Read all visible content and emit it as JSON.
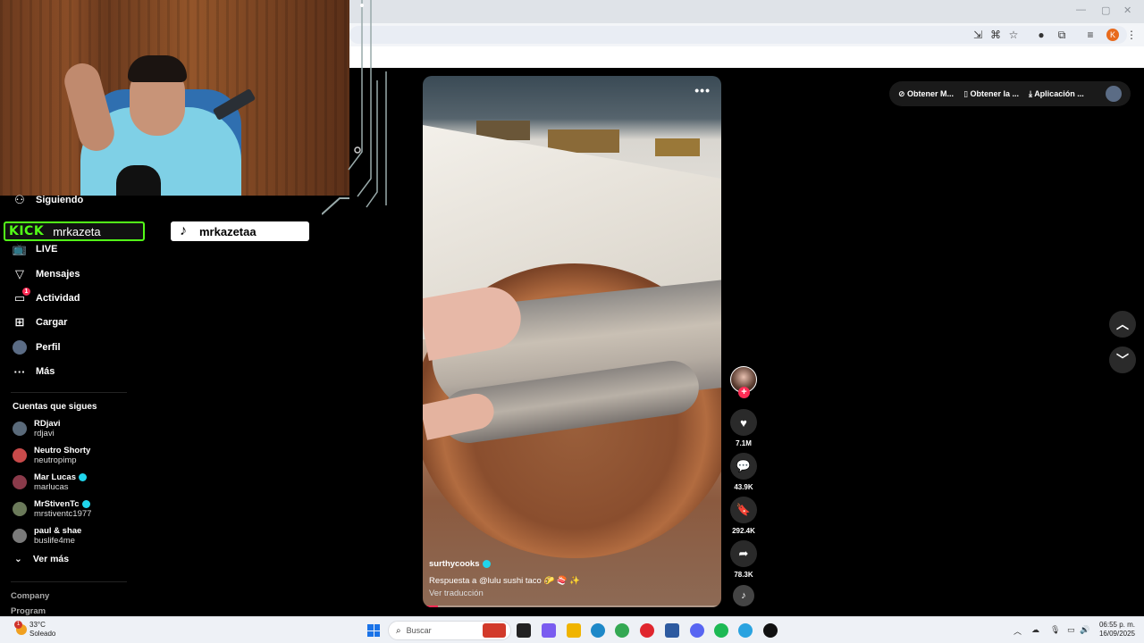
{
  "browser": {
    "minimize": "—",
    "maximize": "▢",
    "close": "✕",
    "profile_initial": "K"
  },
  "sidebar": {
    "items": [
      {
        "label": "Siguiendo",
        "icon": "following-icon"
      },
      {
        "label": "LIVE",
        "icon": "live-icon"
      },
      {
        "label": "Mensajes",
        "icon": "messages-icon"
      },
      {
        "label": "Actividad",
        "icon": "activity-icon",
        "badge": "1"
      },
      {
        "label": "Cargar",
        "icon": "upload-icon"
      },
      {
        "label": "Perfil",
        "icon": "profile-avatar"
      },
      {
        "label": "Más",
        "icon": "more-icon"
      }
    ],
    "following_title": "Cuentas que sigues",
    "accounts": [
      {
        "name": "RDjavi",
        "handle": "rdjavi",
        "verified": false
      },
      {
        "name": "Neutro Shorty",
        "handle": "neutropimp",
        "verified": false
      },
      {
        "name": "Mar Lucas",
        "handle": "marlucas",
        "verified": true
      },
      {
        "name": "MrStivenTc",
        "handle": "mrstiventc1977",
        "verified": true
      },
      {
        "name": "paul & shae",
        "handle": "buslife4me",
        "verified": false
      }
    ],
    "see_more": "Ver más",
    "footer": [
      "Company",
      "Program"
    ]
  },
  "overlay": {
    "kick_logo": "KICK",
    "kick_name": "mrkazeta",
    "tiktok_name": "mrkazetaa"
  },
  "video": {
    "username": "surthycooks",
    "description": "Respuesta a @lulu  sushi taco 🌮 🍣 ✨",
    "translate": "Ver traducción",
    "progress": 0.05,
    "more": "•••"
  },
  "actions": {
    "likes": "7.1M",
    "comments": "43.9K",
    "saves": "292.4K",
    "shares": "78.3K"
  },
  "topbar": {
    "item1": "Obtener M...",
    "item2": "Obtener la ...",
    "item3": "Aplicación ..."
  },
  "taskbar": {
    "temp": "33°C",
    "weather": "Soleado",
    "search_placeholder": "Buscar",
    "time": "06:55 p. m.",
    "date": "16/09/2025"
  }
}
